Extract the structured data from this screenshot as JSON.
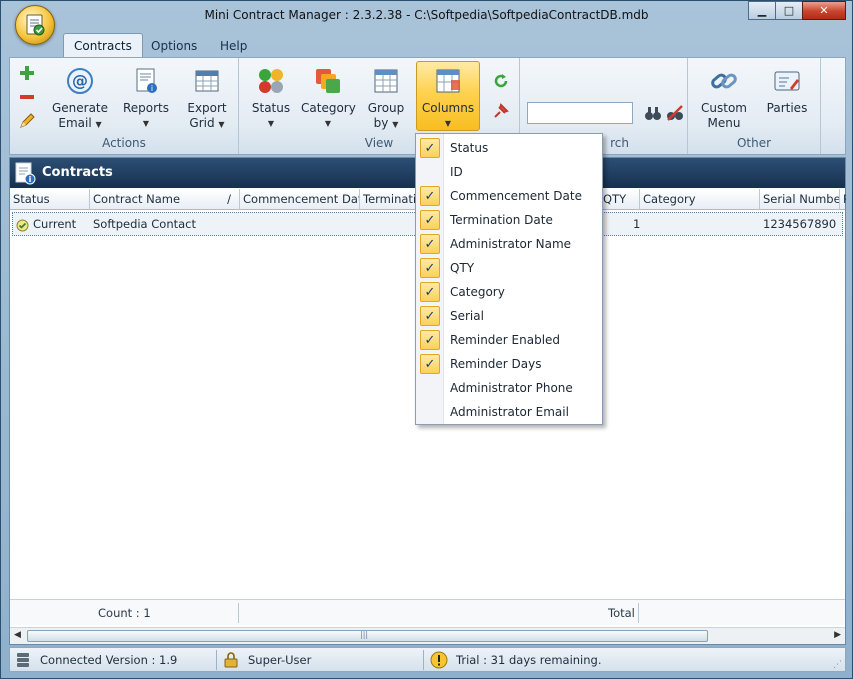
{
  "window": {
    "title": "Mini Contract Manager : 2.3.2.38 - C:\\Softpedia\\SoftpediaContractDB.mdb",
    "controls": {
      "minimize": "▁",
      "maximize": "□",
      "close": "✕"
    }
  },
  "ribbon": {
    "tabs": [
      "Contracts",
      "Options",
      "Help"
    ],
    "active_tab": "Contracts",
    "actions": {
      "label": "Actions",
      "generate_email": [
        "Generate",
        "Email"
      ],
      "reports": "Reports",
      "export_grid": [
        "Export",
        "Grid"
      ]
    },
    "view": {
      "label": "View",
      "status": "Status",
      "category": "Category",
      "group_by": [
        "Group",
        "by"
      ],
      "columns": "Columns"
    },
    "search": {
      "label": "rch",
      "value": ""
    },
    "other": {
      "label": "Other",
      "custom_menu": [
        "Custom",
        "Menu"
      ],
      "parties": "Parties"
    }
  },
  "panel": {
    "title": "Contracts",
    "columns": [
      "Status",
      "Contract Name",
      "Commencement Date",
      "Terminatio",
      "QTY",
      "Category",
      "Serial Number",
      "R"
    ],
    "sort_indicator": "/",
    "rows": [
      {
        "status": "Current",
        "name": "Softpedia Contact",
        "qty": "1",
        "serial": "1234567890"
      }
    ],
    "summary": {
      "count": "Count : 1",
      "total": "Total"
    },
    "scroll_grip": "|||"
  },
  "statusbar": {
    "connection": "Connected Version : 1.9",
    "user": "Super-User",
    "trial": "Trial : 31 days remaining."
  },
  "columns_menu": {
    "items": [
      {
        "label": "Status",
        "checked": true
      },
      {
        "label": "ID",
        "checked": false
      },
      {
        "label": "Commencement Date",
        "checked": true
      },
      {
        "label": "Termination Date",
        "checked": true
      },
      {
        "label": "Administrator Name",
        "checked": true
      },
      {
        "label": "QTY",
        "checked": true
      },
      {
        "label": "Category",
        "checked": true
      },
      {
        "label": "Serial",
        "checked": true
      },
      {
        "label": "Reminder Enabled",
        "checked": true
      },
      {
        "label": "Reminder Days",
        "checked": true
      },
      {
        "label": "Administrator Phone",
        "checked": false
      },
      {
        "label": "Administrator Email",
        "checked": false
      }
    ],
    "check_glyph": "✓"
  },
  "colors": {
    "panel_header": "#1f3d5f",
    "hot_button": "#fed24f",
    "check_fill": "#fcd159"
  }
}
